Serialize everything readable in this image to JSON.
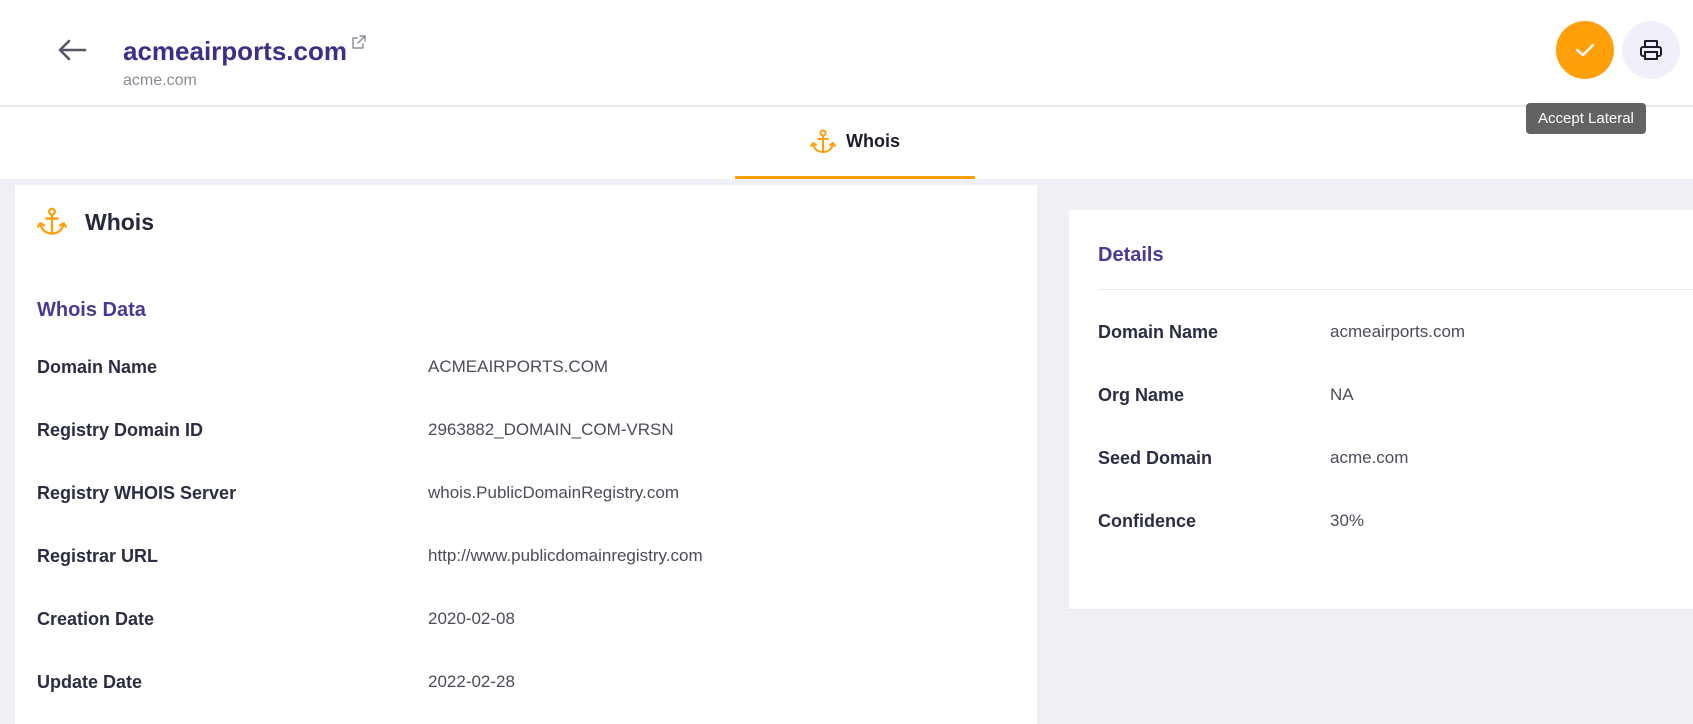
{
  "header": {
    "title": "acmeairports.com",
    "subtitle": "acme.com",
    "accept_tooltip": "Accept Lateral"
  },
  "icons": {
    "back": "arrow-left-icon",
    "external": "external-link-icon",
    "accept": "check-icon",
    "print": "printer-icon",
    "anchor": "anchor-icon"
  },
  "colors": {
    "brand": "#3d2f86",
    "accent": "#ff9f0a",
    "section": "#4a3a95"
  },
  "tabs": [
    {
      "label": "Whois",
      "active": true
    }
  ],
  "whois": {
    "title": "Whois",
    "section_title": "Whois Data",
    "rows": [
      {
        "key": "Domain Name",
        "value": "ACMEAIRPORTS.COM"
      },
      {
        "key": "Registry Domain ID",
        "value": "2963882_DOMAIN_COM-VRSN"
      },
      {
        "key": "Registry WHOIS Server",
        "value": "whois.PublicDomainRegistry.com"
      },
      {
        "key": "Registrar URL",
        "value": "http://www.publicdomainregistry.com"
      },
      {
        "key": "Creation Date",
        "value": "2020-02-08"
      },
      {
        "key": "Update Date",
        "value": "2022-02-28"
      }
    ]
  },
  "details": {
    "title": "Details",
    "rows": [
      {
        "key": "Domain Name",
        "value": "acmeairports.com"
      },
      {
        "key": "Org Name",
        "value": "NA"
      },
      {
        "key": "Seed Domain",
        "value": "acme.com"
      },
      {
        "key": "Confidence",
        "value": "30%"
      }
    ]
  }
}
